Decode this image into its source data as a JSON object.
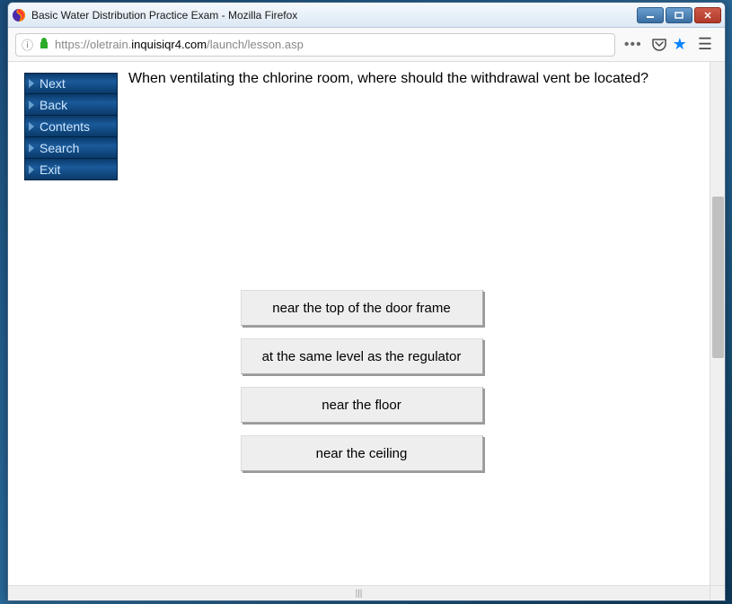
{
  "window": {
    "title": "Basic Water Distribution Practice Exam - Mozilla Firefox"
  },
  "url": {
    "prefix": "https://oletrain.",
    "domain": "inquisiqr4.com",
    "path": "/launch/lesson.asp"
  },
  "sidebar": {
    "items": [
      {
        "label": "Next"
      },
      {
        "label": "Back"
      },
      {
        "label": "Contents"
      },
      {
        "label": "Search"
      },
      {
        "label": "Exit"
      }
    ]
  },
  "question": {
    "text": "When ventilating the chlorine room, where should the withdrawal vent be located?"
  },
  "answers": [
    {
      "label": "near the top of the door frame"
    },
    {
      "label": "at the same level as the regulator"
    },
    {
      "label": "near the floor"
    },
    {
      "label": "near the ceiling"
    }
  ]
}
